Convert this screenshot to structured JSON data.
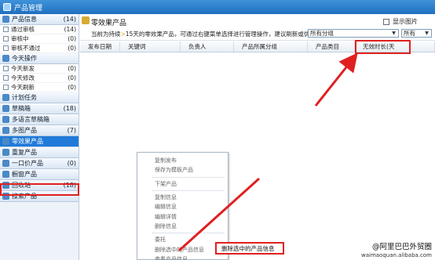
{
  "window": {
    "title": "产品管理"
  },
  "notice": {
    "title": "零效果产品",
    "prefix": "当前为持续",
    "arrow_glyph": ">",
    "text": "15天的零效果产品，可通过右键菜单选择进行管理操作，建议刷新或优化产品。"
  },
  "toolbar": {
    "show_images_label": "显示图片",
    "group_select": "所有分组",
    "filter_select": "所有"
  },
  "sidebar": [
    {
      "type": "header",
      "label": "产品信息",
      "count": "(14)",
      "icon": "product-info-icon"
    },
    {
      "type": "item",
      "label": "通过审核",
      "count": "(14)"
    },
    {
      "type": "item",
      "label": "审核中",
      "count": "(0)"
    },
    {
      "type": "item",
      "label": "审核不通过",
      "count": "(0)"
    },
    {
      "type": "header",
      "label": "今天操作",
      "count": "",
      "icon": "today-icon"
    },
    {
      "type": "item",
      "label": "今天新发",
      "count": "(0)"
    },
    {
      "type": "item",
      "label": "今天修改",
      "count": "(0)"
    },
    {
      "type": "item",
      "label": "今天刷新",
      "count": "(0)"
    },
    {
      "type": "header",
      "label": "计划任务",
      "count": "",
      "icon": "clock-icon"
    },
    {
      "type": "header",
      "label": "草稿箱",
      "count": "(18)",
      "icon": "draft-icon"
    },
    {
      "type": "header",
      "label": "多语言草稿箱",
      "count": "",
      "icon": "multilang-icon"
    },
    {
      "type": "header",
      "label": "多图产品",
      "count": "(7)",
      "icon": "images-icon"
    },
    {
      "type": "header",
      "label": "零效果产品",
      "count": "",
      "icon": "zero-effect-icon",
      "selected": true
    },
    {
      "type": "header",
      "label": "重复产品",
      "count": "",
      "icon": "duplicate-icon"
    },
    {
      "type": "header",
      "label": "一口价产品",
      "count": "(0)",
      "icon": "price-icon"
    },
    {
      "type": "header",
      "label": "橱窗产品",
      "count": "",
      "icon": "showcase-icon"
    },
    {
      "type": "header",
      "label": "回收站",
      "count": "(18)",
      "icon": "trash-icon"
    },
    {
      "type": "header",
      "label": "搜索产品",
      "count": "",
      "icon": "search-icon"
    }
  ],
  "grid": {
    "columns": [
      "发布日期",
      "关键词",
      "负责人",
      "产品所属分组",
      "产品类目",
      "无效时长(天"
    ]
  },
  "context_menu": {
    "items": [
      "复制发布",
      "保存为模板产品",
      "",
      "下架产品",
      "",
      "复制信息",
      "编辑信息",
      "编辑详情",
      "删除信息",
      "",
      "委托",
      "删除选中的产品信息",
      "查看产品信息"
    ],
    "selected": "删除选中的产品信息"
  },
  "watermark": {
    "line1": "@阿里巴巴外贸圈",
    "line2": "waimaoquan.alibaba.com"
  },
  "colors": {
    "titlebar": "#1f6fbf",
    "selected": "#1f7ad9",
    "highlight": "#e02020",
    "arrow": "#e02020"
  }
}
